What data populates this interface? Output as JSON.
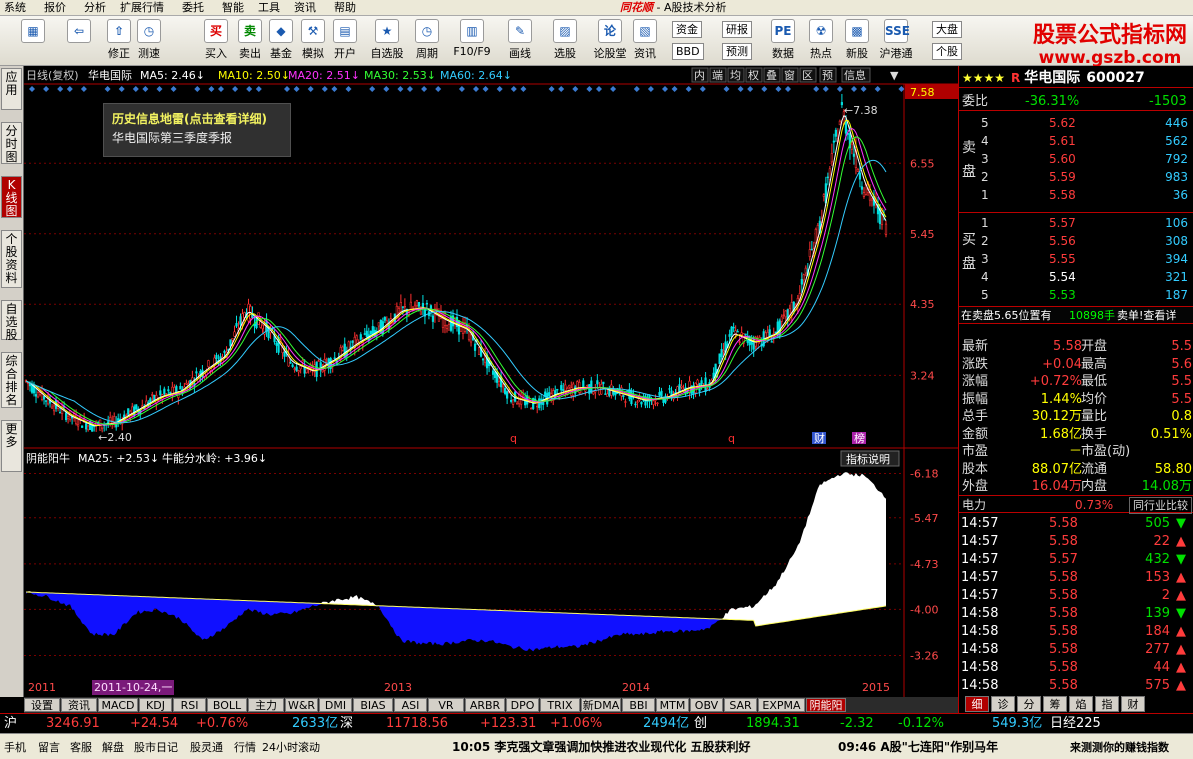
{
  "menu": [
    "系统",
    "报价",
    "分析",
    "扩展行情",
    "委托",
    "智能",
    "工具",
    "资讯",
    "帮助"
  ],
  "app_title_logo": "同花顺",
  "app_title_suffix": " - A股技术分析",
  "toolbar": {
    "buttons": [
      {
        "label": "",
        "glyph": "▦"
      },
      {
        "label": "",
        "glyph": "⇦"
      },
      {
        "label": "修正",
        "glyph": "⇧"
      },
      {
        "label": "测速",
        "glyph": "◷"
      },
      {
        "label": "买入",
        "glyph": "买"
      },
      {
        "label": "卖出",
        "glyph": "卖"
      },
      {
        "label": "基金",
        "glyph": "◆"
      },
      {
        "label": "模拟",
        "glyph": "⚒"
      },
      {
        "label": "开户",
        "glyph": "▤"
      },
      {
        "label": "自选股",
        "glyph": "★"
      },
      {
        "label": "周期",
        "glyph": "◷"
      },
      {
        "label": "F10/F9",
        "glyph": "▥"
      },
      {
        "label": "画线",
        "glyph": "✎"
      },
      {
        "label": "选股",
        "glyph": "▨"
      },
      {
        "label": "论股堂",
        "glyph": "论"
      },
      {
        "label": "资讯",
        "glyph": "▧"
      },
      {
        "label": "数据",
        "glyph": "PE"
      },
      {
        "label": "热点",
        "glyph": "☢"
      },
      {
        "label": "新股",
        "glyph": "▩"
      },
      {
        "label": "沪港通",
        "glyph": "SSE"
      }
    ],
    "small": [
      "资金",
      "BBD",
      "研报",
      "预测",
      "大盘",
      "个股"
    ],
    "watermark_l1": "股票公式指标网",
    "watermark_l2": "www.gszb.com"
  },
  "left_tabs": [
    "应用",
    "分时图",
    "K线图",
    "个股资料",
    "自选股",
    "综合排名",
    "更多"
  ],
  "chart": {
    "title": "日线(复权)",
    "name": "华电国际",
    "ma": [
      {
        "label": "MA5: 2.46",
        "color": "#ffffff"
      },
      {
        "label": "MA10: 2.50",
        "color": "#ffff00"
      },
      {
        "label": "MA20: 2.51",
        "color": "#ff33ff"
      },
      {
        "label": "MA30: 2.53",
        "color": "#33ff33"
      },
      {
        "label": "MA60: 2.64",
        "color": "#33ccff"
      }
    ],
    "top_buttons": [
      "内",
      "端",
      "均",
      "权",
      "叠",
      "窗",
      "区",
      "预",
      "信息"
    ],
    "price_current": "7.58",
    "y_labels": [
      "6.55",
      "5.45",
      "4.35",
      "3.24"
    ],
    "high_label": "7.38",
    "low_label": "2.40",
    "event_marks": [
      "q",
      "q",
      "财",
      "榜"
    ],
    "indicator_title": "阴能阳牛",
    "indicator_ma": "MA25: +2.53",
    "indicator_water": "牛能分水岭: +3.96",
    "indicator_help": "指标说明",
    "ind_y_labels": [
      "6.18",
      "5.47",
      "4.73",
      "4.00",
      "3.26"
    ],
    "x_labels": [
      "2011",
      "2013",
      "2014",
      "2015"
    ],
    "cursor_date": "2011-10-24,一"
  },
  "chart_data": {
    "type": "line",
    "note_x": "trading-day index over 2011–2015",
    "close": [
      3.15,
      2.85,
      2.6,
      2.45,
      2.5,
      2.7,
      2.9,
      3.0,
      3.3,
      3.55,
      4.25,
      3.95,
      3.45,
      3.3,
      3.5,
      3.75,
      3.95,
      4.25,
      4.3,
      4.1,
      3.95,
      3.4,
      2.9,
      2.8,
      2.95,
      3.05,
      3.05,
      2.95,
      2.85,
      2.9,
      3.05,
      3.1,
      3.9,
      3.75,
      3.9,
      4.4,
      5.6,
      7.38,
      6.2,
      5.6
    ],
    "ylim": [
      2.2,
      7.6
    ],
    "indicator": [
      4.28,
      4.2,
      4.05,
      3.6,
      3.6,
      3.95,
      4.0,
      3.85,
      3.5,
      3.7,
      4.0,
      3.92,
      3.93,
      4.05,
      4.15,
      4.2,
      4.05,
      3.5,
      3.45,
      3.45,
      3.5,
      3.5,
      3.4,
      3.35,
      3.4,
      3.4,
      3.5,
      3.6,
      3.6,
      3.65,
      3.65,
      3.7,
      4.0,
      4.05,
      4.4,
      5.0,
      6.0,
      6.18,
      6.15,
      5.8
    ],
    "water_line": 3.96,
    "ind_ylim": [
      2.9,
      6.3
    ]
  },
  "tooltip": {
    "title": "历史信息地雷(点击查看详细)",
    "body": "华电国际第三季度季报"
  },
  "quote": {
    "stars": "★★★★",
    "flag": "R",
    "name": "华电国际",
    "code": "600027",
    "wb_label": "委比",
    "wb_val": "-36.31%",
    "wb_diff": "-1503",
    "sell_label": "卖盘",
    "buy_label": "买盘",
    "sell": [
      [
        "5",
        "5.62",
        "446"
      ],
      [
        "4",
        "5.61",
        "562"
      ],
      [
        "3",
        "5.60",
        "792"
      ],
      [
        "2",
        "5.59",
        "983"
      ],
      [
        "1",
        "5.58",
        "36"
      ]
    ],
    "buy": [
      [
        "1",
        "5.57",
        "106"
      ],
      [
        "2",
        "5.56",
        "308"
      ],
      [
        "3",
        "5.55",
        "394"
      ],
      [
        "4",
        "5.54",
        "321"
      ],
      [
        "5",
        "5.53",
        "187"
      ]
    ],
    "notice_a": "在卖盘5.65位置有",
    "notice_b": "10898手",
    "notice_c": "卖单!查看详",
    "stats": [
      [
        "最新",
        "5.58",
        "开盘",
        "5.5"
      ],
      [
        "涨跌",
        "+0.04",
        "最高",
        "5.6"
      ],
      [
        "涨幅",
        "+0.72%",
        "最低",
        "5.5"
      ],
      [
        "振幅",
        "1.44%",
        "均价",
        "5.5"
      ],
      [
        "总手",
        "30.12万",
        "量比",
        "0.8"
      ],
      [
        "金额",
        "1.68亿",
        "换手",
        "0.51%"
      ],
      [
        "市盈",
        "－",
        "市盈(动)",
        ""
      ],
      [
        "股本",
        "88.07亿",
        "流通",
        "58.80"
      ],
      [
        "外盘",
        "16.04万",
        "内盘",
        "14.08万"
      ]
    ],
    "sector": "电力",
    "sector_pct": "0.73%",
    "sector_btn": "同行业比较",
    "ticks": [
      [
        "14:57",
        "5.58",
        "505",
        "down"
      ],
      [
        "14:57",
        "5.58",
        "22",
        "up"
      ],
      [
        "14:57",
        "5.57",
        "432",
        "down"
      ],
      [
        "14:57",
        "5.58",
        "153",
        "up"
      ],
      [
        "14:57",
        "5.58",
        "2",
        "up"
      ],
      [
        "14:58",
        "5.58",
        "139",
        "down"
      ],
      [
        "14:58",
        "5.58",
        "184",
        "up"
      ],
      [
        "14:58",
        "5.58",
        "277",
        "up"
      ],
      [
        "14:58",
        "5.58",
        "44",
        "up"
      ],
      [
        "14:58",
        "5.58",
        "575",
        "up"
      ]
    ],
    "tabs": [
      "细",
      "诊",
      "分",
      "筹",
      "焰",
      "指",
      "财"
    ]
  },
  "bottom_tabs": [
    "设置",
    "资讯",
    "MACD",
    "KDJ",
    "RSI",
    "BOLL",
    "主力",
    "W&R",
    "DMI",
    "BIAS",
    "ASI",
    "VR",
    "ARBR",
    "DPO",
    "TRIX",
    "新DMA",
    "BBI",
    "MTM",
    "OBV",
    "SAR",
    "EXPMA",
    "阴能阳牛"
  ],
  "index_bar": {
    "sh_label": "沪",
    "sh_val": "3246.91",
    "sh_chg": "+24.54",
    "sh_pct": "+0.76%",
    "sh_amt": "2633亿",
    "sz_label": "深",
    "sz_val": "11718.56",
    "sz_chg": "+123.31",
    "sz_pct": "+1.06%",
    "sz_amt": "2494亿",
    "cy_label": "创",
    "cy_val": "1894.31",
    "cy_chg": "-2.32",
    "cy_pct": "-0.12%",
    "cy_amt": "549.3亿",
    "rj_label": "日经225"
  },
  "status": {
    "items": [
      "手机",
      "留言",
      "客服",
      "解盘",
      "股市日记",
      "股灵通",
      "行情",
      "24小时滚动"
    ],
    "news1": "10:05 李克强文章强调加快推进农业现代化 五股获利好",
    "news2": "09:46 A股\"七连阳\"作别马年",
    "news3": "来测测你的赚钱指数"
  }
}
